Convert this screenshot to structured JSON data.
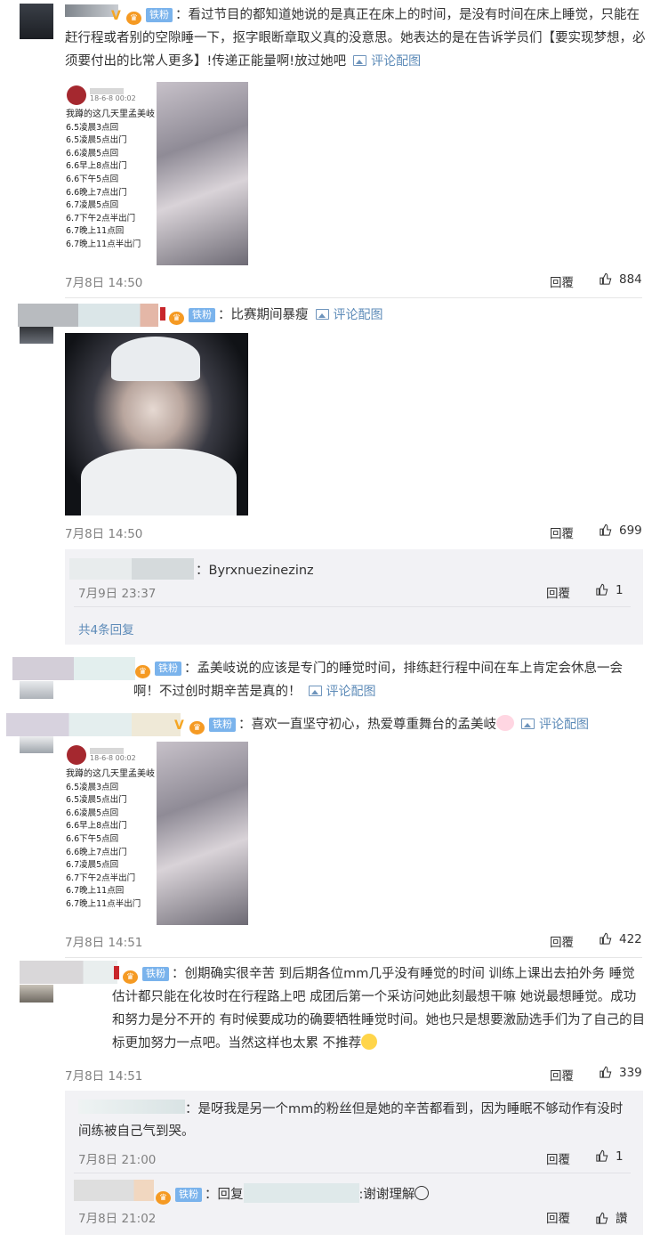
{
  "labels": {
    "fan_badge": "铁粉",
    "reply": "回覆",
    "pic_link": "评论配图"
  },
  "comments": [
    {
      "text": "：看过节目的都知道她说的是真正在床上的时间，是没有时间在床上睡觉，只能在赶行程或者别的空隙睡一下，抠字眼断章取义真的没意思。她表达的是在告诉学员们【要实现梦想，必须要付出的比常人更多】!传递正能量啊!放过她吧",
      "time": "7月8日 14:50",
      "likes": "884",
      "image_text": {
        "header": "18-6-8 00:02",
        "title": "我蹲的这几天里孟美岐",
        "lines": [
          "6.5凌晨3点回",
          "6.5凌晨5点出门",
          "6.6凌晨5点回",
          "6.6早上8点出门",
          "6.6下午5点回",
          "6.6晚上7点出门",
          "6.7凌晨5点回",
          "6.7下午2点半出门",
          "6.7晚上11点回",
          "6.7晚上11点半出门"
        ]
      }
    },
    {
      "text": "：比赛期间暴瘦",
      "time": "7月8日 14:50",
      "likes": "699",
      "replies": [
        {
          "text": "：Byrxnuezinezinz",
          "time": "7月9日 23:37",
          "likes": "1"
        }
      ],
      "more": "共4条回复"
    },
    {
      "text": "：孟美岐说的应该是专门的睡觉时间，排练赶行程中间在车上肯定会休息一会啊！不过创时期辛苦是真的！"
    },
    {
      "text": "：喜欢一直坚守初心，热爱尊重舞台的孟美岐",
      "time": "7月8日 14:51",
      "likes": "422",
      "image_text": {
        "header": "18-6-8 00:02",
        "title": "我蹲的这几天里孟美岐",
        "lines": [
          "6.5凌晨3点回",
          "6.5凌晨5点出门",
          "6.6凌晨5点回",
          "6.6早上8点出门",
          "6.6下午5点回",
          "6.6晚上7点出门",
          "6.7凌晨5点回",
          "6.7下午2点半出门",
          "6.7晚上11点回",
          "6.7晚上11点半出门"
        ]
      }
    },
    {
      "text": "：创期确实很辛苦 到后期各位mm几乎没有睡觉的时间 训练上课出去拍外务 睡觉估计都只能在化妆时在行程路上吧 成团后第一个采访问她此刻最想干嘛 她说最想睡觉。成功和努力是分不开的 有时候要成功的确要牺牲睡觉时间。她也只是想要激励选手们为了自己的目标更加努力一点吧。当然这样也太累 不推荐",
      "time": "7月8日 14:51",
      "likes": "339",
      "replies": [
        {
          "text": "：是呀我是另一个mm的粉丝但是她的辛苦都看到，因为睡眠不够动作有没时间练被自己气到哭。",
          "time": "7月8日 21:00",
          "likes": "1"
        },
        {
          "text_prefix": "：回复",
          "text_suffix": ":谢谢理解",
          "time": "7月8日 21:02",
          "likes": "讚"
        }
      ]
    }
  ]
}
